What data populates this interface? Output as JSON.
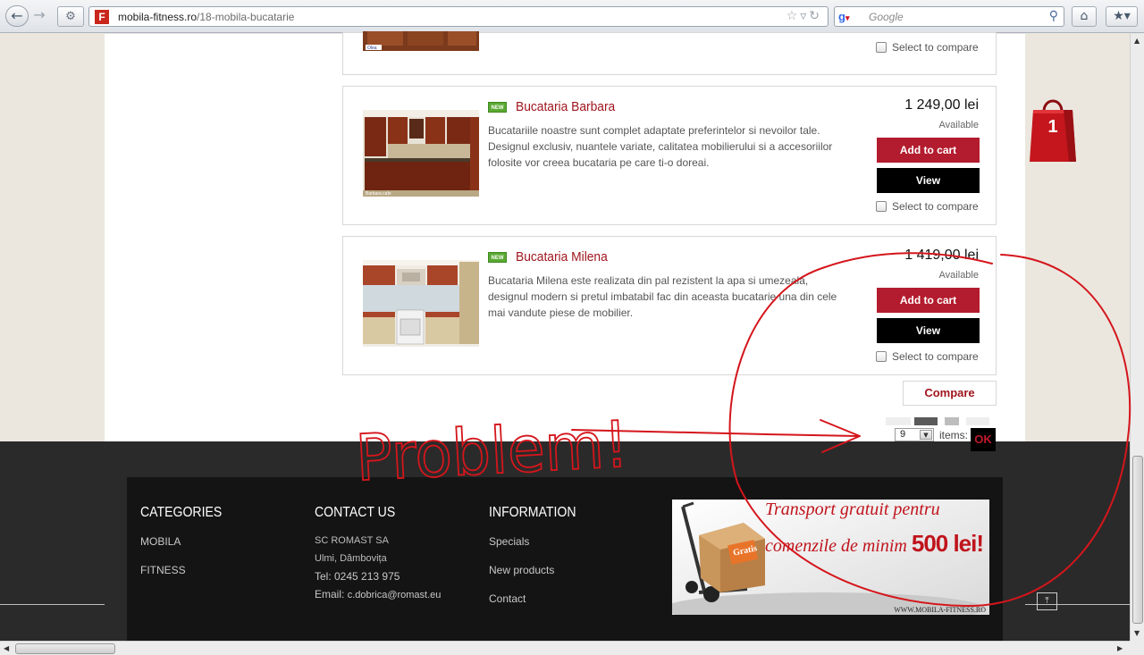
{
  "browser": {
    "url_host": "mobila-fitness.ro",
    "url_path": "/18-mobila-bucatarie",
    "search_placeholder": "Google"
  },
  "products": [
    {
      "name": "Bucataria Barbara",
      "badge": "NEW",
      "description": "Bucatariile noastre sunt complet adaptate preferintelor si nevoilor tale. Designul exclusiv, nuantele variate, calitatea mobilierului si a accesoriilor folosite vor creea bucataria pe care ti-o doreai.",
      "price": "1 249,00 lei",
      "availability": "Available",
      "add_to_cart": "Add to cart",
      "view": "View",
      "compare_label": "Select to compare",
      "thumb_caption": "Barbara cafe"
    },
    {
      "name": "Bucataria Milena",
      "badge": "NEW",
      "description": "Bucataria Milena este realizata din pal rezistent la apa si umezeala, designul modern si pretul imbatabil fac din aceasta bucatarie una din cele mai vandute piese de mobilier.",
      "price": "1 419,00 lei",
      "availability": "Available",
      "add_to_cart": "Add to cart",
      "view": "View",
      "compare_label": "Select to compare"
    }
  ],
  "previous_item": {
    "compare_label": "Select to compare",
    "thumb_caption": "Olea"
  },
  "listing": {
    "compare_button": "Compare",
    "per_page_value": "9",
    "items_label": "items:",
    "ok_button": "OK"
  },
  "cart": {
    "count": "1",
    "color": "#c4161c"
  },
  "footer": {
    "categories": {
      "title": "CATEGORIES",
      "links": [
        "MOBILA",
        "FITNESS"
      ]
    },
    "contact": {
      "title": "CONTACT US",
      "company": "SC ROMAST SA",
      "city": "Ulmi, Dâmbovița",
      "phone": "Tel: 0245 213 975",
      "email_label": "Email:",
      "email": "c.dobrica@romast.eu"
    },
    "information": {
      "title": "INFORMATION",
      "links": [
        "Specials",
        "New products",
        "Contact"
      ]
    },
    "promo": {
      "line1": "Transport gratuit  pentru",
      "line2": "comenzile de minim",
      "amount": "500 lei!",
      "box_label": "Gratis",
      "site": "WWW.MOBILA-FITNESS.RO"
    }
  },
  "annotation": {
    "text": "Problem!",
    "color": "#d4161c"
  }
}
